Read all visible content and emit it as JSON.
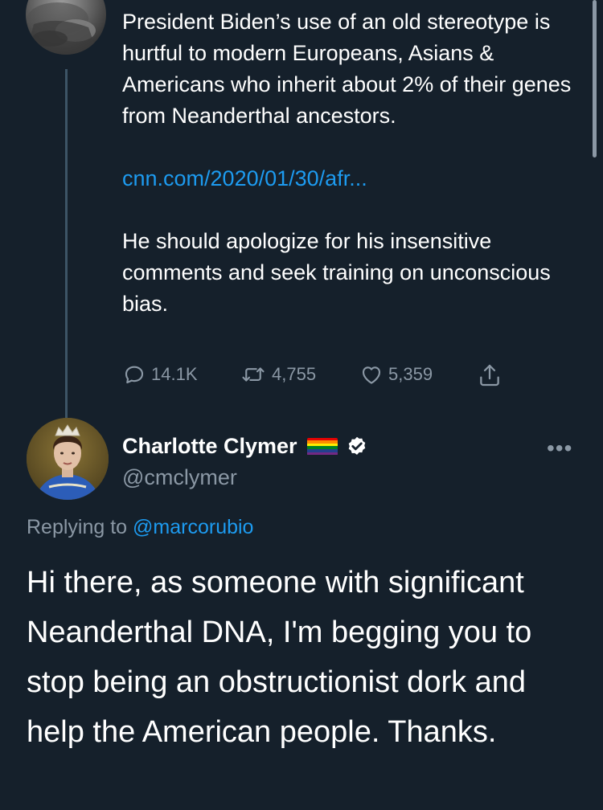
{
  "previous_tweet": {
    "text_1": "President Biden’s use of an old stereotype is hurtful to modern Europeans, Asians & Americans who inherit about 2% of their genes from Neanderthal ancestors.",
    "link": "cnn.com/2020/01/30/afr...",
    "text_2": "He should apologize for his insensitive comments and seek training on unconscious bias.",
    "actions": {
      "replies": "14.1K",
      "retweets": "4,755",
      "likes": "5,359"
    }
  },
  "reply_tweet": {
    "author_name": "Charlotte Clymer",
    "author_handle": "@cmclymer",
    "replying_prefix": "Replying to",
    "replying_to": "@marcorubio",
    "text": "Hi there, as someone with significant Neanderthal DNA, I'm begging you to stop being an obstructionist dork and help the American people. Thanks."
  },
  "colors": {
    "background": "#15202b",
    "text": "#ffffff",
    "secondary": "#8b98a5",
    "link": "#1d9bf0",
    "thread_line": "#3d5466"
  },
  "icons": {
    "reply": "reply-icon",
    "retweet": "retweet-icon",
    "like": "heart-icon",
    "share": "share-icon",
    "verified": "verified-badge-icon",
    "flag": "rainbow-flag-icon",
    "more": "more-options-icon"
  }
}
